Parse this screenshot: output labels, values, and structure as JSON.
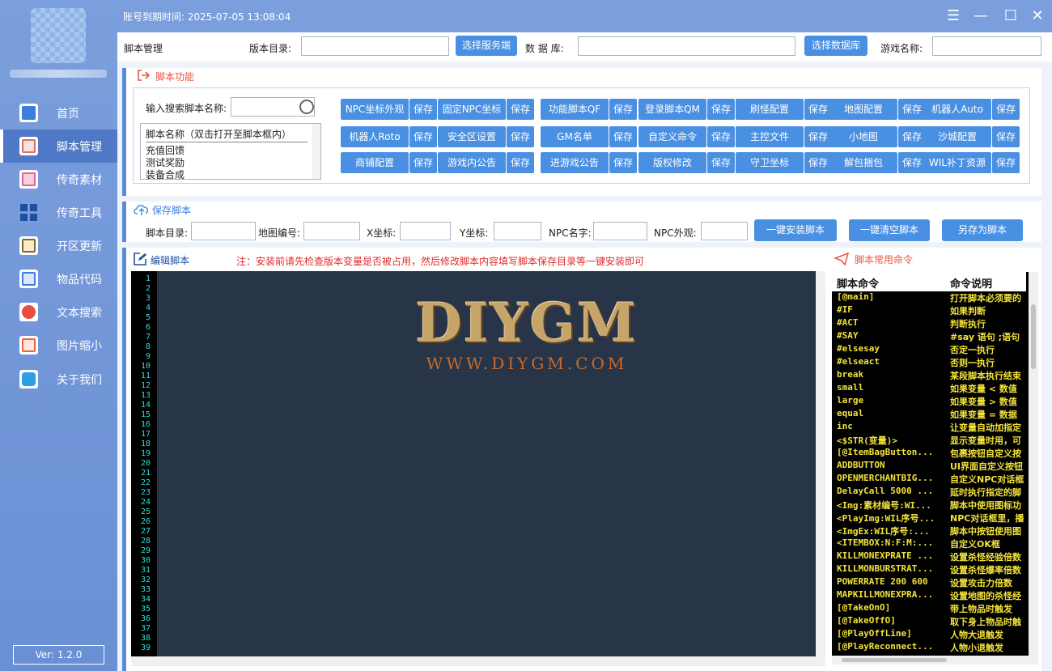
{
  "title_bar": {
    "expire_label": "账号到期时间:",
    "expire_time": "2025-07-05 13:08:04",
    "menu_glyph": "☰",
    "min_glyph": "—",
    "max_glyph": "☐",
    "close_glyph": "✕"
  },
  "sidebar": {
    "items": [
      {
        "label": "首页",
        "icon": "home-icon"
      },
      {
        "label": "脚本管理",
        "icon": "script-icon"
      },
      {
        "label": "传奇素材",
        "icon": "image-icon"
      },
      {
        "label": "传奇工具",
        "icon": "grid-icon"
      },
      {
        "label": "开区更新",
        "icon": "refresh-icon"
      },
      {
        "label": "物品代码",
        "icon": "code-icon"
      },
      {
        "label": "文本搜索",
        "icon": "search-icon"
      },
      {
        "label": "图片缩小",
        "icon": "shrink-icon"
      },
      {
        "label": "关于我们",
        "icon": "at-icon"
      }
    ],
    "active_index": 1,
    "version": "Ver: 1.2.0"
  },
  "topbar": {
    "breadcrumb": "脚本管理",
    "version_dir_label": "版本目录:",
    "version_dir_value": "",
    "select_server_btn": "选择服务端",
    "db_label": "数 据 库:",
    "db_value": "",
    "select_db_btn": "选择数据库",
    "game_name_label": "游戏名称:",
    "game_name_value": ""
  },
  "func": {
    "title": "脚本功能",
    "search_label": "输入搜索脚本名称:",
    "search_value": "",
    "list_header": "脚本名称（双击打开至脚本框内）",
    "list_items": [
      "充值回馈",
      "测试奖励",
      "装备合成"
    ],
    "save_label": "保存",
    "buttons": [
      [
        "NPC坐标外观",
        "固定NPC坐标",
        "功能脚本QF",
        "登录脚本QM",
        "刷怪配置",
        "地图配置",
        "机器人Auto"
      ],
      [
        "机器人Roto",
        "安全区设置",
        "GM名单",
        "自定义命令",
        "主控文件",
        "小地图",
        "沙城配置"
      ],
      [
        "商铺配置",
        "游戏内公告",
        "进游戏公告",
        "版权修改",
        "守卫坐标",
        "解包捆包",
        "WIL补丁资源"
      ]
    ]
  },
  "save_script": {
    "title": "保存脚本",
    "dir_label": "脚本目录:",
    "map_label": "地图编号:",
    "x_label": "X坐标:",
    "y_label": "Y坐标:",
    "npc_name_label": "NPC名字:",
    "npc_look_label": "NPC外观:",
    "install_btn": "一键安装脚本",
    "clear_btn": "一键清空脚本",
    "saveas_btn": "另存为脚本"
  },
  "editor": {
    "title": "编辑脚本",
    "note": "注：安装前请先检查版本变量是否被占用，然后修改脚本内容填写脚本保存目录等一键安装即可",
    "watermark_main": "DIYGM",
    "watermark_sub": "WWW.DIYGM.COM",
    "line_numbers": [
      "1",
      "2",
      "3",
      "4",
      "5",
      "6",
      "7",
      "8",
      "9",
      "10",
      "11",
      "12",
      "13",
      "14",
      "15",
      "16",
      "17",
      "18",
      "19",
      "20",
      "21",
      "22",
      "23",
      "24",
      "25",
      "26",
      "27",
      "28",
      "29",
      "30",
      "31",
      "32",
      "33",
      "34",
      "35",
      "36",
      "37",
      "38",
      "39"
    ]
  },
  "commands": {
    "title": "脚本常用命令",
    "col1": "脚本命令",
    "col2": "命令说明",
    "rows": [
      [
        "[@main]",
        "打开脚本必须要的"
      ],
      [
        "#IF",
        "如果判断"
      ],
      [
        "#ACT",
        "判断执行"
      ],
      [
        "#SAY",
        "#say 语句 ;语句"
      ],
      [
        "#elsesay",
        "否定一执行"
      ],
      [
        "#elseact",
        "否则一执行"
      ],
      [
        "break",
        "某段脚本执行结束"
      ],
      [
        "small",
        "如果变量 < 数值"
      ],
      [
        "large",
        "如果变量 > 数值"
      ],
      [
        "equal",
        "如果变量 = 数据"
      ],
      [
        "inc",
        "让变量自动加指定"
      ],
      [
        "<$STR(变量)>",
        "显示变量时用，可"
      ],
      [
        "[@ItemBagButton...",
        "包裹按钮自定义按"
      ],
      [
        "ADDBUTTON",
        "UI界面自定义按钮"
      ],
      [
        "OPENMERCHANTBIG...",
        "自定义NPC对话框"
      ],
      [
        "DelayCall 5000 ...",
        "延时执行指定的脚"
      ],
      [
        "<Img:素材编号:WI...",
        "脚本中使用图标功"
      ],
      [
        "<PlayImg:WIL序号...",
        "NPC对话框里，播"
      ],
      [
        "<ImgEx:WIL序号:...",
        "脚本中按钮使用图"
      ],
      [
        "<ITEMBOX:N:F:M:...",
        "自定义OK框"
      ],
      [
        "KILLMONEXPRATE ...",
        "设置杀怪经验倍数"
      ],
      [
        "KILLMONBURSTRAT...",
        "设置杀怪爆率倍数"
      ],
      [
        "POWERRATE 200 600",
        "设置攻击力倍数"
      ],
      [
        "MAPKILLMONEXPRA...",
        "设置地图的杀怪经"
      ],
      [
        "[@TakeOnO]",
        "带上物品时触发"
      ],
      [
        "[@TakeOffO]",
        "取下身上物品时触"
      ],
      [
        "[@PlayOffLine]",
        "人物大退触发"
      ],
      [
        "[@PlayReconnect...",
        "人物小退触发"
      ]
    ]
  }
}
